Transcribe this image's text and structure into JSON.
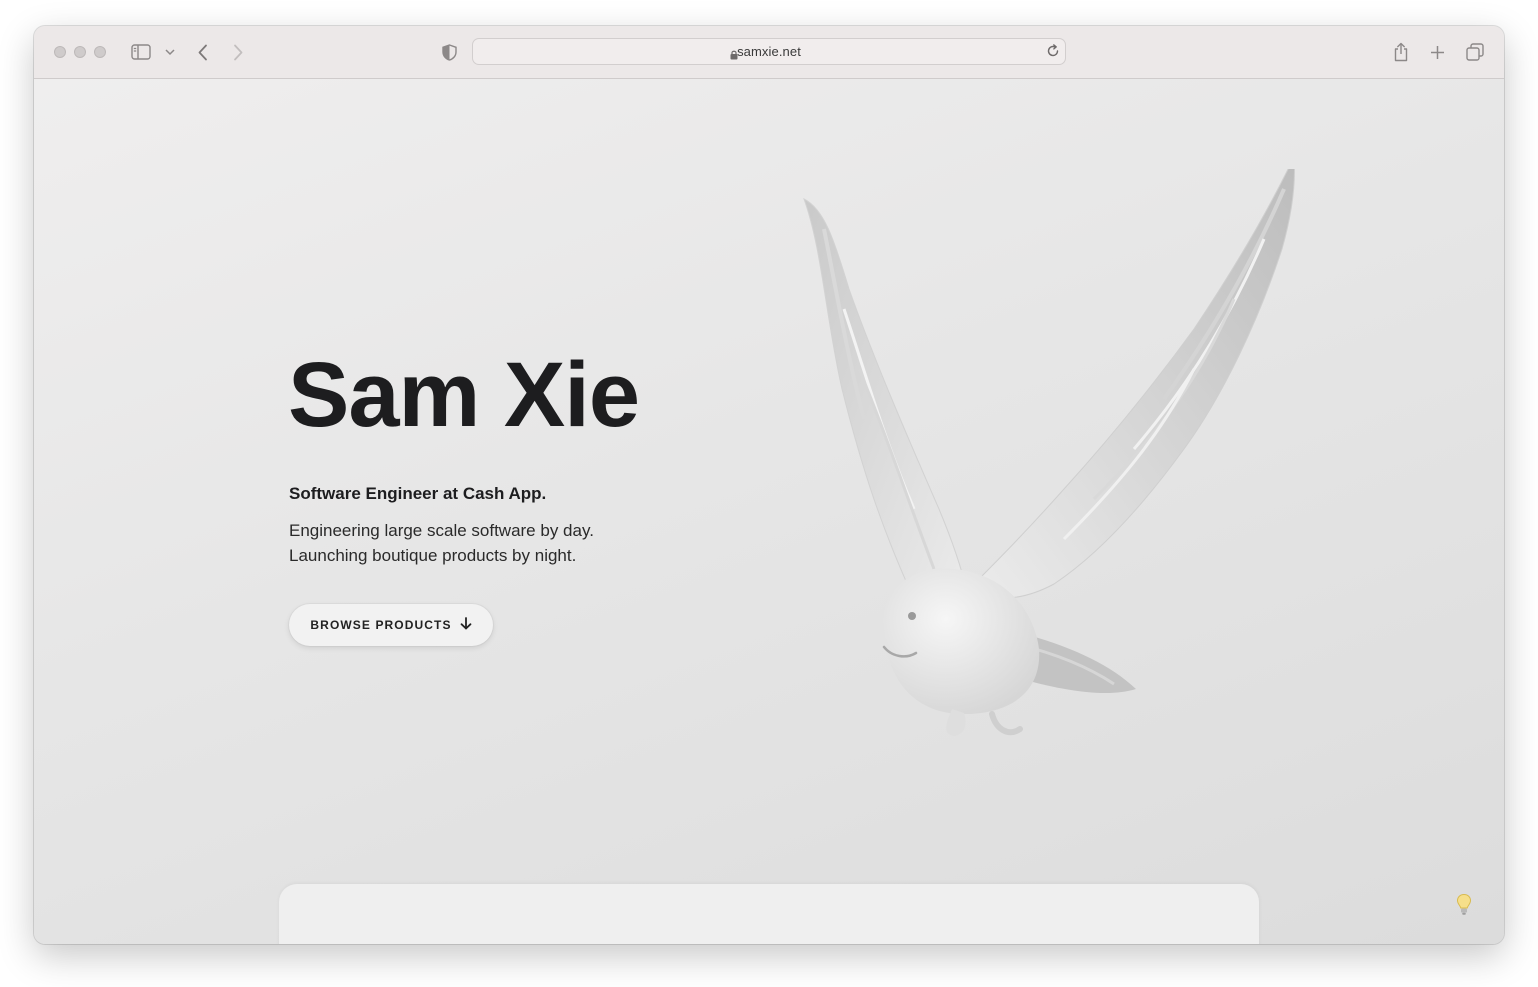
{
  "browser": {
    "url": "samxie.net",
    "icons": {
      "sidebar": "sidebar-icon",
      "chevron": "chevron-down-icon",
      "back": "back-icon",
      "forward": "forward-icon",
      "shield": "privacy-shield-icon",
      "lock": "lock-icon",
      "reload": "reload-icon",
      "share": "share-icon",
      "new_tab": "plus-icon",
      "tabs": "tab-overview-icon"
    }
  },
  "hero": {
    "name": "Sam Xie",
    "role": "Software Engineer at Cash App.",
    "line1": "Engineering large scale software by day.",
    "line2": "Launching boutique products by night.",
    "cta_label": "BROWSE PRODUCTS",
    "cta_icon": "arrow-down-icon",
    "illustration": "bird-illustration"
  },
  "theme_toggle_icon": "lightbulb-icon",
  "colors": {
    "text": "#1d1d1f",
    "background": "#e4e4e4",
    "button_bg": "#f2f2f2",
    "toolbar": "#ece8e8"
  }
}
